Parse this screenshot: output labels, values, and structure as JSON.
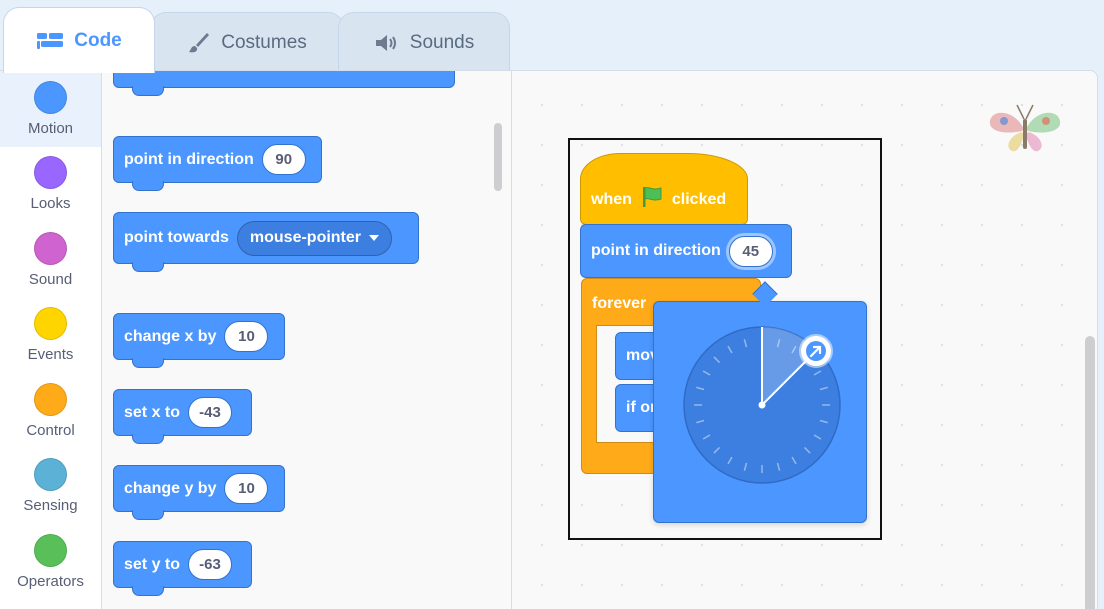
{
  "tabs": [
    {
      "label": "Code",
      "icon": "code-icon",
      "active": true
    },
    {
      "label": "Costumes",
      "icon": "brush-icon",
      "active": false
    },
    {
      "label": "Sounds",
      "icon": "speaker-icon",
      "active": false
    }
  ],
  "categories": [
    {
      "label": "Motion",
      "color": "#4c97ff",
      "selected": true
    },
    {
      "label": "Looks",
      "color": "#9966ff"
    },
    {
      "label": "Sound",
      "color": "#cf63cf"
    },
    {
      "label": "Events",
      "color": "#ffd500"
    },
    {
      "label": "Control",
      "color": "#ffab19"
    },
    {
      "label": "Sensing",
      "color": "#5cb1d6"
    },
    {
      "label": "Operators",
      "color": "#59c059"
    }
  ],
  "palette": {
    "point_in_direction": {
      "label": "point in direction",
      "value": "90"
    },
    "point_towards": {
      "label": "point towards",
      "value": "mouse-pointer"
    },
    "change_x": {
      "label": "change x by",
      "value": "10"
    },
    "set_x": {
      "label": "set x to",
      "value": "-43"
    },
    "change_y": {
      "label": "change y by",
      "value": "10"
    },
    "set_y": {
      "label": "set y to",
      "value": "-63"
    }
  },
  "script": {
    "hat": {
      "when": "when",
      "clicked": "clicked"
    },
    "point_in_direction": {
      "label": "point in direction",
      "value": "45"
    },
    "forever": "forever",
    "move": "move",
    "if_on_edge": "if on e"
  },
  "colors": {
    "motion": "#4c97ff",
    "events": "#ffbf00",
    "control": "#ffab19",
    "flag": "#4cbf56"
  }
}
